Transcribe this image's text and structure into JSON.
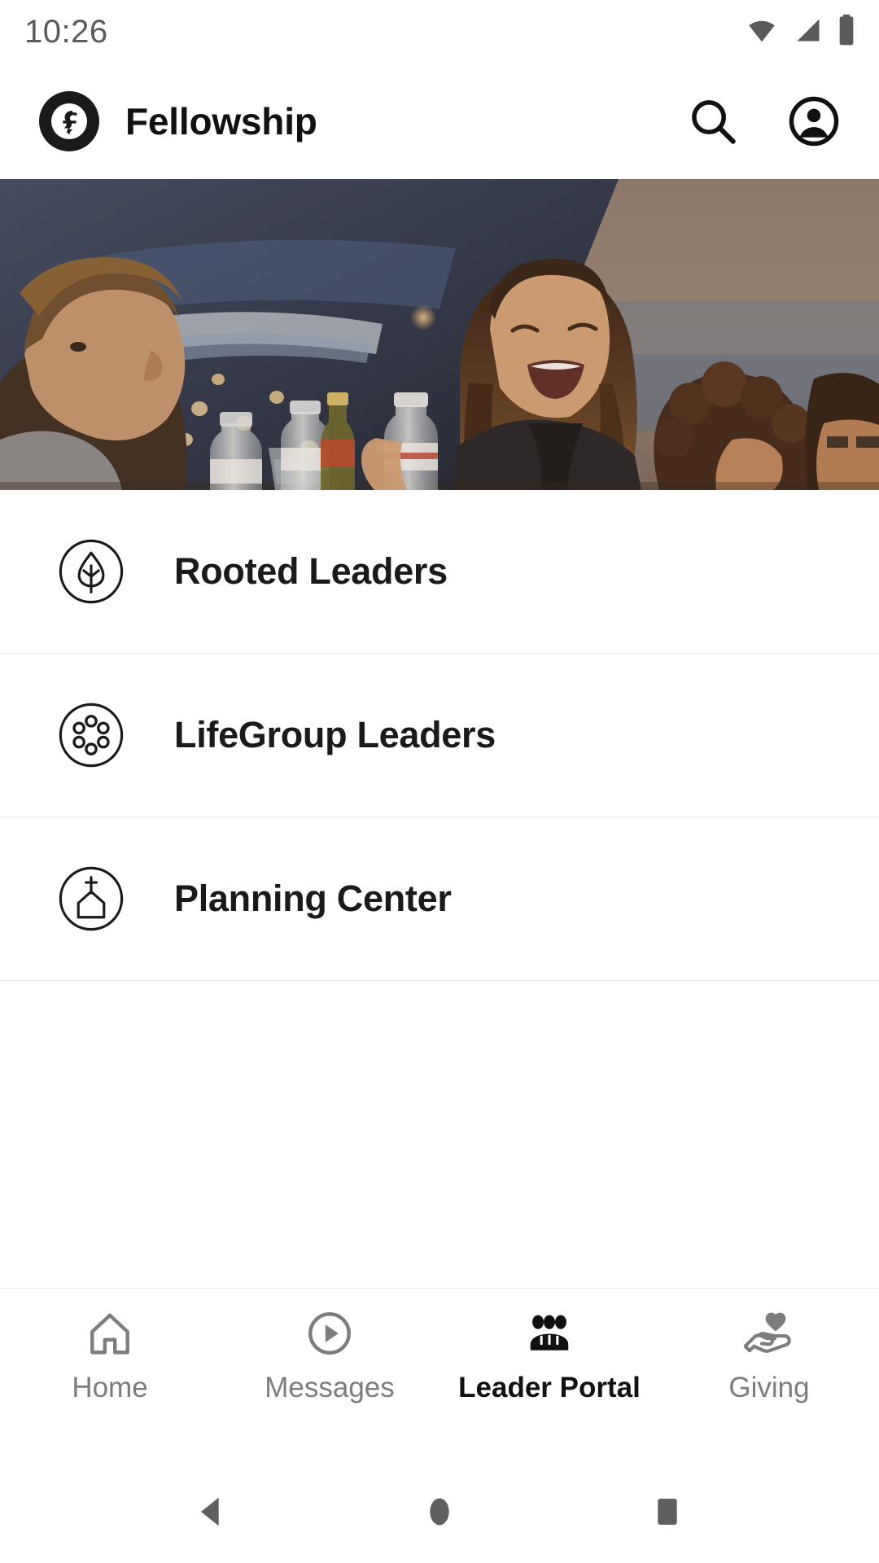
{
  "status_bar": {
    "time": "10:26",
    "icons": [
      "wifi-icon",
      "cellular-signal-icon",
      "battery-icon"
    ],
    "icon_color": "#5a5a5a"
  },
  "app_bar": {
    "logo": "fellowship-logo-icon",
    "title": "Fellowship",
    "actions": [
      {
        "name": "search-icon",
        "label": "Search"
      },
      {
        "name": "account-icon",
        "label": "Account"
      }
    ]
  },
  "hero": {
    "name": "hero-banner-image",
    "alt": "People gathered outdoors at dusk beside a blue car, a woman laughing, water bottles on the table"
  },
  "menu": {
    "items": [
      {
        "label": "Rooted Leaders",
        "icon": "leaf-sprout-icon"
      },
      {
        "label": "LifeGroup Leaders",
        "icon": "group-circles-icon"
      },
      {
        "label": "Planning Center",
        "icon": "church-building-icon"
      }
    ]
  },
  "bottom_nav": {
    "active_index": 2,
    "active_color": "#111111",
    "inactive_color": "#7d7d7d",
    "tabs": [
      {
        "label": "Home",
        "icon": "home-icon"
      },
      {
        "label": "Messages",
        "icon": "play-circle-icon"
      },
      {
        "label": "Leader Portal",
        "icon": "people-group-icon"
      },
      {
        "label": "Giving",
        "icon": "hand-heart-icon"
      }
    ]
  },
  "system_nav": {
    "buttons": [
      {
        "name": "back-button",
        "icon": "triangle-left-icon"
      },
      {
        "name": "home-button",
        "icon": "circle-icon"
      },
      {
        "name": "recents-button",
        "icon": "square-icon"
      }
    ],
    "color": "#5f5f5f"
  }
}
